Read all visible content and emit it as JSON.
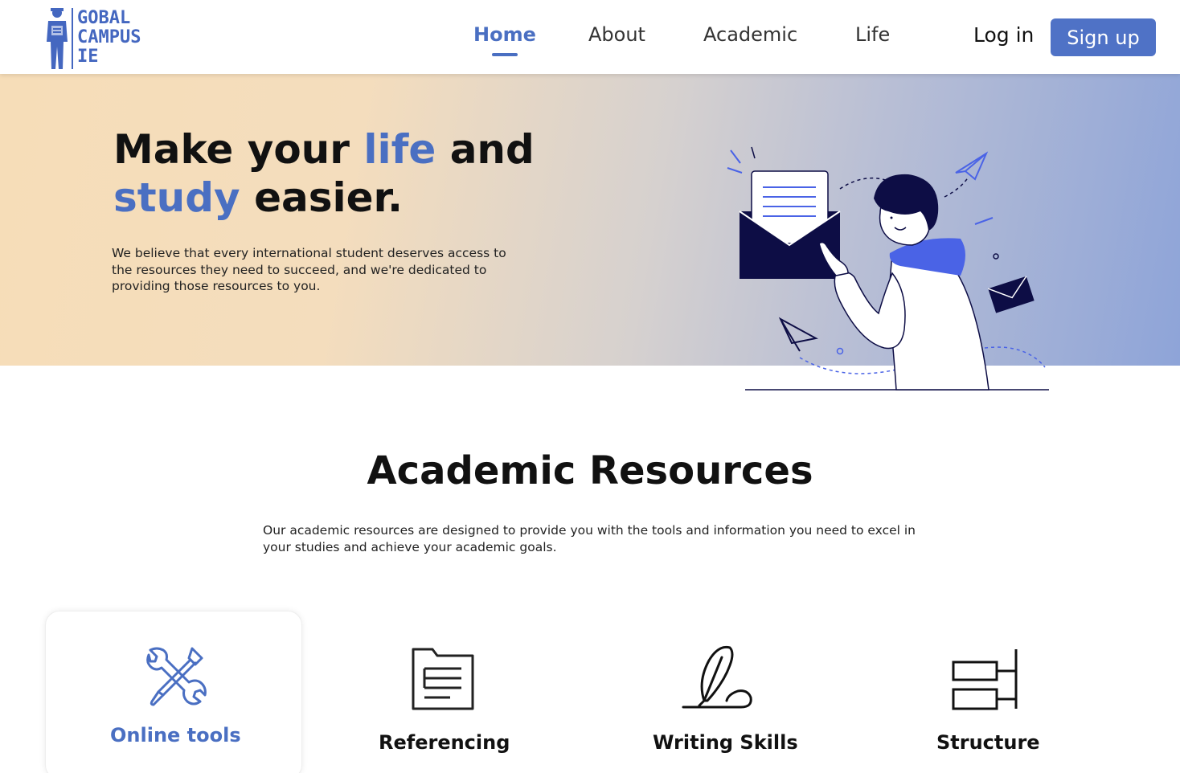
{
  "brand": {
    "logo_lines": [
      "GOBAL",
      "CAMPUS",
      "IE"
    ]
  },
  "nav": {
    "items": [
      {
        "label": "Home",
        "active": true
      },
      {
        "label": "About",
        "active": false
      },
      {
        "label": "Academic",
        "active": false
      },
      {
        "label": "Life",
        "active": false
      }
    ],
    "login_label": "Log in",
    "signup_label": "Sign up"
  },
  "hero": {
    "title_part1": "Make your ",
    "title_accent1": "life",
    "title_part2": " and",
    "title_accent2": "study",
    "title_part3": " easier.",
    "subtitle": "We believe that every international student deserves access to the resources they need to succeed, and we're dedicated to providing those resources to you."
  },
  "resources": {
    "title": "Academic Resources",
    "description": "Our academic resources are designed to provide you with the tools and information you need to excel in your studies and achieve your academic goals.",
    "cards": [
      {
        "label": "Online tools",
        "icon": "tools-icon",
        "active": true
      },
      {
        "label": "Referencing",
        "icon": "document-icon",
        "active": false
      },
      {
        "label": "Writing Skills",
        "icon": "pen-signature-icon",
        "active": false
      },
      {
        "label": "Structure",
        "icon": "structure-icon",
        "active": false
      }
    ]
  },
  "colors": {
    "accent": "#4a6fc2",
    "signup_bg": "#4f72c6",
    "hero_left": "#f6ddb8",
    "hero_right": "#8ea4d8",
    "illustration_dark": "#0d0d45",
    "illustration_blue": "#4a63e6"
  }
}
